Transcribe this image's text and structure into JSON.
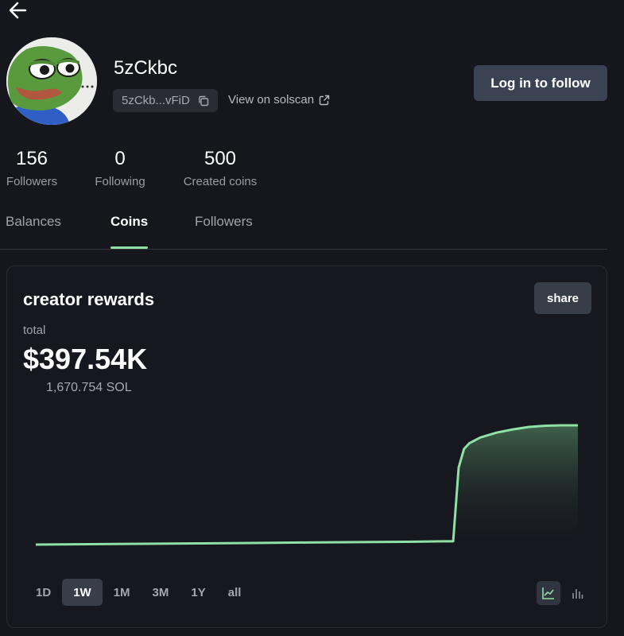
{
  "profile": {
    "username": "5zCkbc",
    "address_short": "5zCkb...vFiD",
    "solscan_label": "View on solscan",
    "follow_label": "Log in to follow"
  },
  "stats": [
    {
      "value": "156",
      "label": "Followers"
    },
    {
      "value": "0",
      "label": "Following"
    },
    {
      "value": "500",
      "label": "Created coins"
    }
  ],
  "tabs": [
    {
      "label": "Balances",
      "active": false
    },
    {
      "label": "Coins",
      "active": true
    },
    {
      "label": "Followers",
      "active": false
    }
  ],
  "card": {
    "title": "creator rewards",
    "share_label": "share",
    "total_label": "total",
    "total_usd": "$397.54K",
    "total_sol": "1,670.754 SOL"
  },
  "ranges": [
    {
      "label": "1D",
      "active": false
    },
    {
      "label": "1W",
      "active": true
    },
    {
      "label": "1M",
      "active": false
    },
    {
      "label": "3M",
      "active": false
    },
    {
      "label": "1Y",
      "active": false
    },
    {
      "label": "all",
      "active": false
    }
  ],
  "icons": {
    "back": "arrow-left-icon",
    "copy": "copy-icon",
    "external": "external-link-icon",
    "line_view": "line-chart-icon",
    "bar_view": "bar-chart-icon"
  },
  "colors": {
    "accent": "#8fe0a4",
    "background": "#16171d",
    "button": "#3a4253"
  },
  "chart_data": {
    "type": "area",
    "x": [
      0,
      10,
      20,
      30,
      40,
      50,
      60,
      70,
      75,
      77,
      78,
      79,
      80,
      82,
      85,
      88,
      91,
      94,
      97,
      100
    ],
    "y": [
      0,
      0.5,
      1,
      1.5,
      2,
      2.5,
      3,
      3.5,
      4,
      4,
      95,
      118,
      125,
      132,
      138,
      142,
      145,
      146.5,
      147,
      147
    ],
    "xlabel": "",
    "ylabel": "",
    "grid": false
  }
}
